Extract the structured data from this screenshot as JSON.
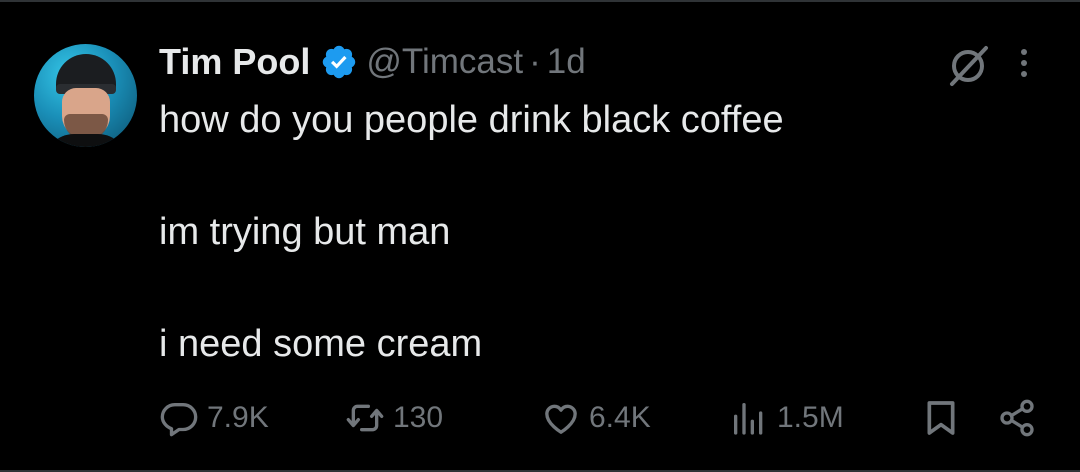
{
  "tweet": {
    "author_name": "Tim Pool",
    "handle": "@Timcast",
    "separator": "·",
    "time": "1d",
    "lines": [
      "how do you people drink black coffee",
      "",
      "im trying but man",
      "",
      "i need some cream"
    ]
  },
  "actions": {
    "replies": "7.9K",
    "retweets": "130",
    "likes": "6.4K",
    "views": "1.5M"
  },
  "colors": {
    "background": "#000000",
    "text": "#e7e9ea",
    "muted": "#71767b",
    "verified": "#1d9bf0"
  },
  "icons": [
    "verified-badge-icon",
    "grok-icon",
    "more-icon",
    "reply-icon",
    "retweet-icon",
    "like-icon",
    "views-icon",
    "bookmark-icon",
    "share-icon"
  ]
}
